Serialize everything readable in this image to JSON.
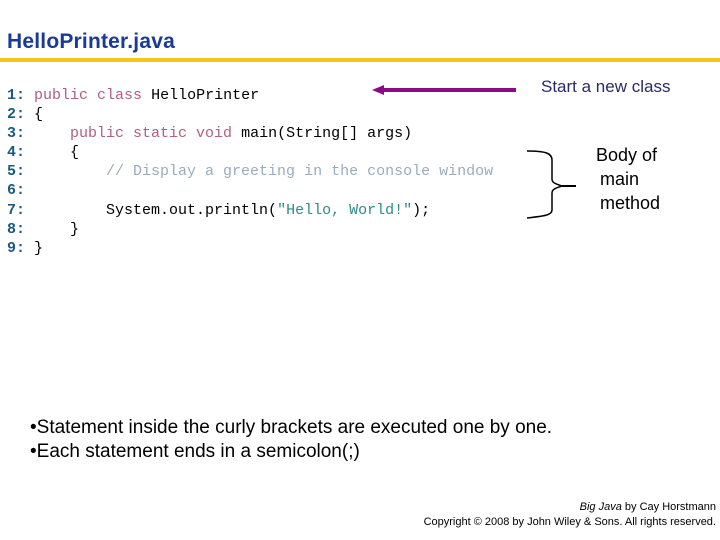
{
  "slide": {
    "title": "HelloPrinter.java",
    "accent_color": "#f5c518",
    "title_color": "#1a3a9a"
  },
  "code": {
    "lines": [
      {
        "num": "1:",
        "indent": " ",
        "tokens": [
          {
            "t": "public class ",
            "c": "kw"
          },
          {
            "t": "HelloPrinter",
            "c": "plain"
          }
        ]
      },
      {
        "num": "2:",
        "indent": " ",
        "tokens": [
          {
            "t": "{",
            "c": "plain"
          }
        ]
      },
      {
        "num": "3:",
        "indent": "     ",
        "tokens": [
          {
            "t": "public static void ",
            "c": "kw"
          },
          {
            "t": "main(String[] args)",
            "c": "plain"
          }
        ]
      },
      {
        "num": "4:",
        "indent": "     ",
        "tokens": [
          {
            "t": "{",
            "c": "plain"
          }
        ]
      },
      {
        "num": "5:",
        "indent": "         ",
        "tokens": [
          {
            "t": "// Display a greeting in the console window",
            "c": "cm"
          }
        ]
      },
      {
        "num": "6:",
        "indent": "",
        "tokens": []
      },
      {
        "num": "7:",
        "indent": "         ",
        "tokens": [
          {
            "t": "System.out.println(",
            "c": "plain"
          },
          {
            "t": "\"Hello, World!\"",
            "c": "str"
          },
          {
            "t": ");",
            "c": "plain"
          }
        ]
      },
      {
        "num": "8:",
        "indent": "     ",
        "tokens": [
          {
            "t": "}",
            "c": "plain"
          }
        ]
      },
      {
        "num": "9:",
        "indent": " ",
        "tokens": [
          {
            "t": "}",
            "c": "plain"
          }
        ]
      }
    ]
  },
  "annotations": {
    "class_note": "Start a new class",
    "body_note": [
      "Body of",
      "main",
      "method"
    ],
    "arrow_color": "#8b0a8b"
  },
  "bullets": [
    "•Statement inside the curly brackets are executed one by one.",
    "•Each statement ends in a semicolon(;)"
  ],
  "footer": {
    "book_title": "Big Java",
    "byline": " by Cay Horstmann",
    "copyright": "Copyright © 2008 by John Wiley & Sons.  All rights reserved."
  }
}
